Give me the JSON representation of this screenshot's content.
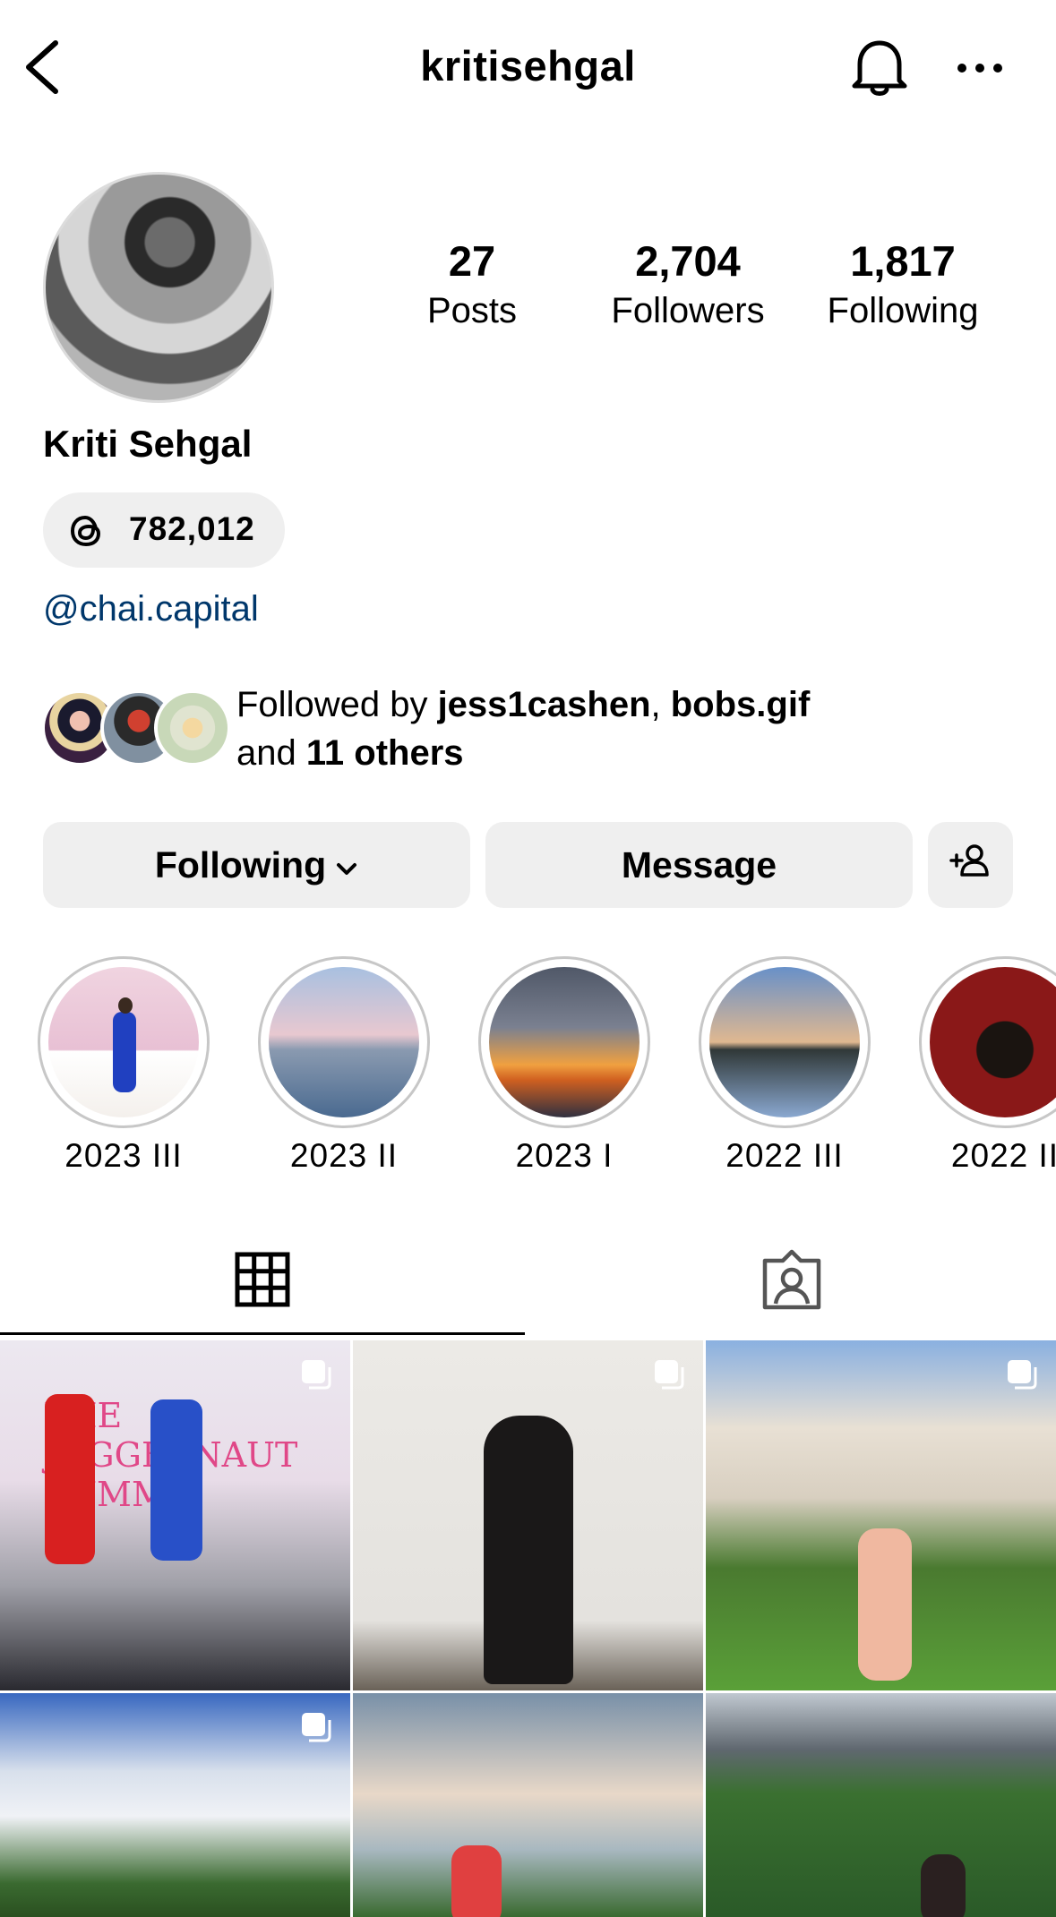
{
  "header": {
    "username": "kritisehgal"
  },
  "profile": {
    "stats": [
      {
        "value": "27",
        "label": "Posts"
      },
      {
        "value": "2,704",
        "label": "Followers"
      },
      {
        "value": "1,817",
        "label": "Following"
      }
    ],
    "name": "Kriti Sehgal",
    "threads_count": "782,012",
    "link": "@chai.capital",
    "followed_by": {
      "prefix": "Followed by ",
      "user1": "jess1cashen",
      "sep": ", ",
      "user2": "bobs.gif",
      "and": "and ",
      "others": "11 others"
    }
  },
  "actions": {
    "following_label": "Following",
    "message_label": "Message"
  },
  "highlights": [
    {
      "label": "2023 III"
    },
    {
      "label": "2023 II"
    },
    {
      "label": "2023 I"
    },
    {
      "label": "2022 III"
    },
    {
      "label": "2022 II"
    }
  ],
  "tabs": [
    {
      "icon": "grid-icon",
      "selected": true
    },
    {
      "icon": "tagged-icon",
      "selected": false
    }
  ],
  "posts": [
    {
      "multiple": true,
      "overlay_text": "THE JUGGERNAUT SUMMIT"
    },
    {
      "multiple": true
    },
    {
      "multiple": true
    },
    {
      "multiple": true
    },
    {
      "multiple": false
    },
    {
      "multiple": false
    }
  ],
  "colors": {
    "link": "#00376b",
    "button_bg": "#efefef"
  }
}
